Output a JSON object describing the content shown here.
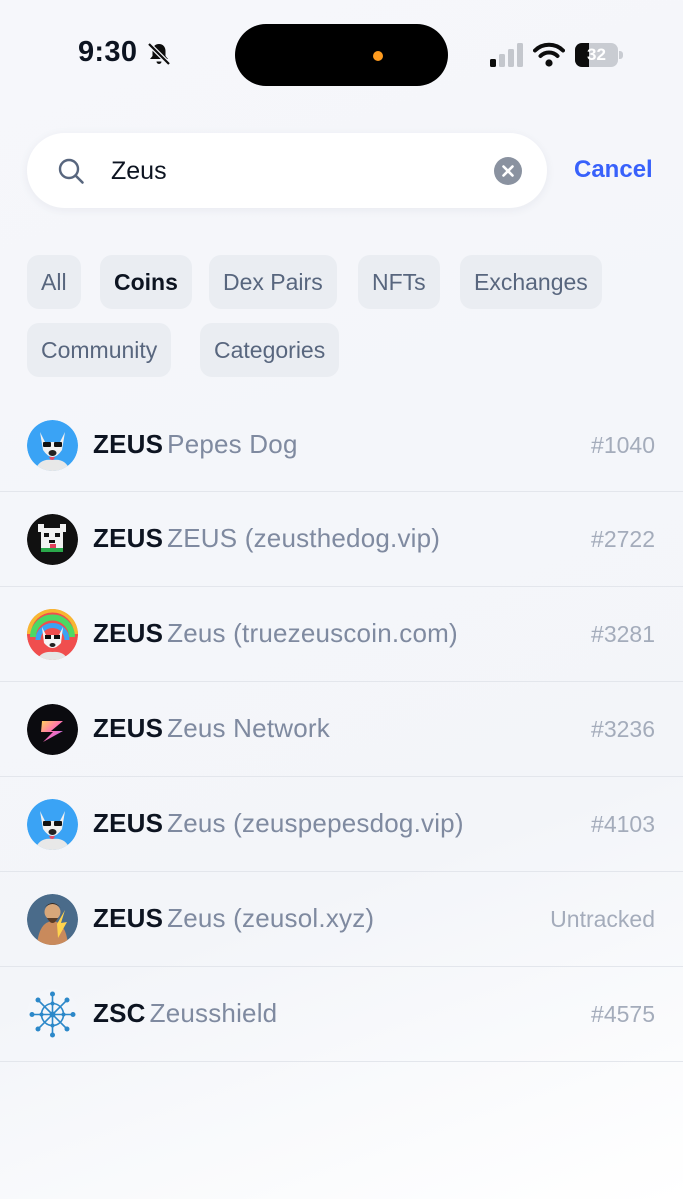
{
  "status_bar": {
    "time": "9:30",
    "battery_level": "32",
    "battery_fraction": 0.32
  },
  "search": {
    "value": "Zeus",
    "placeholder": "",
    "cancel_label": "Cancel"
  },
  "filters": [
    {
      "label": "All",
      "active": false
    },
    {
      "label": "Coins",
      "active": true
    },
    {
      "label": "Dex Pairs",
      "active": false
    },
    {
      "label": "NFTs",
      "active": false
    },
    {
      "label": "Exchanges",
      "active": false
    },
    {
      "label": "Community",
      "active": false
    },
    {
      "label": "Categories",
      "active": false
    }
  ],
  "results": [
    {
      "symbol": "ZEUS",
      "name": "Pepes Dog",
      "rank": "#1040",
      "icon": "white-dog-blue-icon"
    },
    {
      "symbol": "ZEUS",
      "name": "ZEUS (zeusthedog.vip)",
      "rank": "#2722",
      "icon": "pixel-dog-black-icon"
    },
    {
      "symbol": "ZEUS",
      "name": "Zeus (truezeuscoin.com)",
      "rank": "#3281",
      "icon": "rainbow-dog-icon"
    },
    {
      "symbol": "ZEUS",
      "name": "Zeus Network",
      "rank": "#3236",
      "icon": "lightning-bolt-icon"
    },
    {
      "symbol": "ZEUS",
      "name": "Zeus (zeuspepesdog.vip)",
      "rank": "#4103",
      "icon": "white-dog-blue-icon"
    },
    {
      "symbol": "ZEUS",
      "name": "Zeus (zeusol.xyz)",
      "rank": "Untracked",
      "icon": "zeus-god-icon"
    },
    {
      "symbol": "ZSC",
      "name": "Zeusshield",
      "rank": "#4575",
      "icon": "network-orb-icon"
    }
  ],
  "colors": {
    "accent": "#3861fb",
    "text_primary": "#0d1421",
    "text_secondary": "#7f8aa0",
    "chip_bg": "#eaedf2"
  }
}
